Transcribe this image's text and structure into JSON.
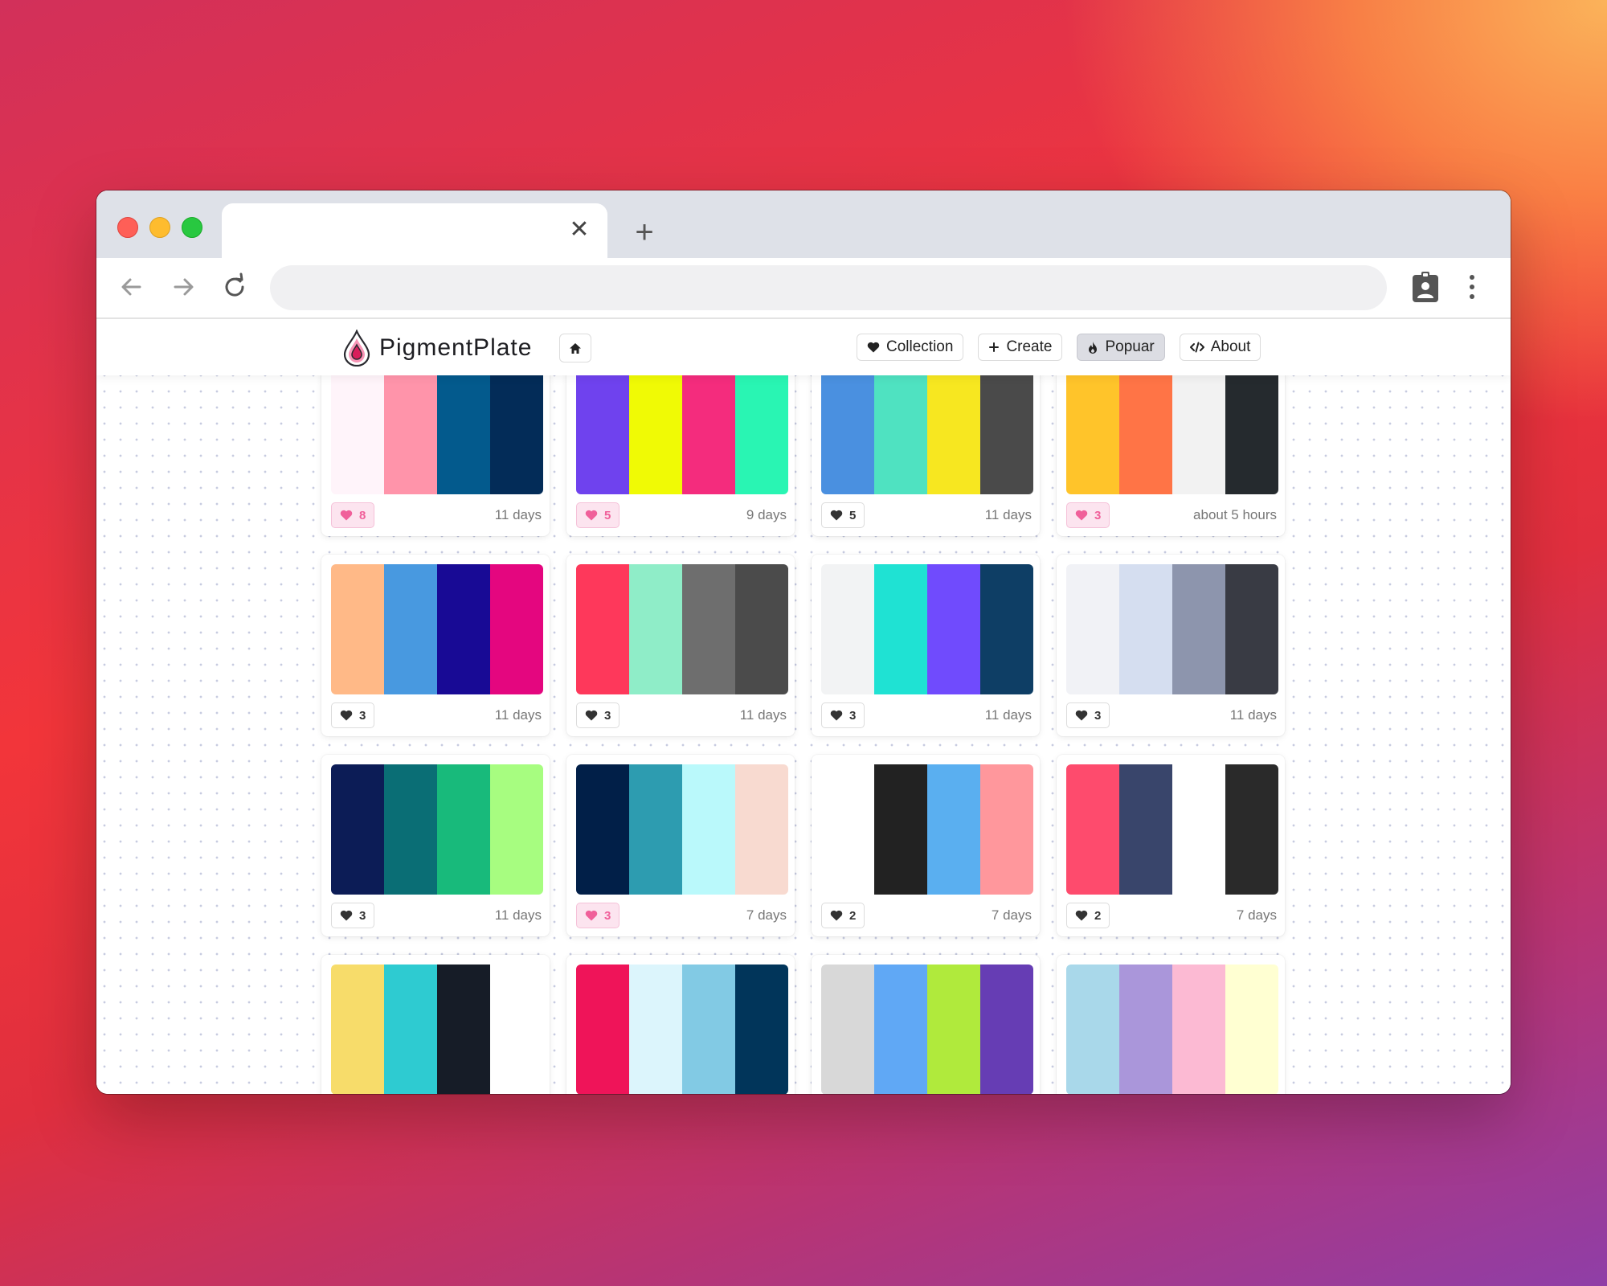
{
  "browser": {
    "tab_close_glyph": "✕",
    "new_tab_glyph": "+"
  },
  "site": {
    "brand": "PigmentPlate",
    "nav": [
      {
        "label": "Collection",
        "icon": "heart-icon"
      },
      {
        "label": "Create",
        "icon": "plus-icon"
      },
      {
        "label": "Popuar",
        "icon": "fire-icon",
        "active": true
      },
      {
        "label": "About",
        "icon": "code-icon"
      }
    ]
  },
  "palettes": [
    {
      "colors": [
        "#fff4fa",
        "#ff94aa",
        "#035a8d",
        "#032c58"
      ],
      "likes": "8",
      "liked": true,
      "age": "11 days"
    },
    {
      "colors": [
        "#6f42ee",
        "#f0fa05",
        "#f42c7d",
        "#29f5b3"
      ],
      "likes": "5",
      "liked": true,
      "age": "9 days"
    },
    {
      "colors": [
        "#4a90e0",
        "#4fe2c1",
        "#f7e720",
        "#4a4a4a"
      ],
      "likes": "5",
      "liked": false,
      "age": "11 days"
    },
    {
      "colors": [
        "#ffc42a",
        "#ff7446",
        "#f2f2f2",
        "#252a2e"
      ],
      "likes": "3",
      "liked": true,
      "age": "about 5 hours"
    },
    {
      "colors": [
        "#ffb987",
        "#4899e0",
        "#180a95",
        "#e4067f"
      ],
      "likes": "3",
      "liked": false,
      "age": "11 days"
    },
    {
      "colors": [
        "#fe385b",
        "#8fedc8",
        "#6e6e6e",
        "#4b4b4b"
      ],
      "likes": "3",
      "liked": false,
      "age": "11 days"
    },
    {
      "colors": [
        "#f2f3f4",
        "#1fe2d3",
        "#704bfd",
        "#0e3e65"
      ],
      "likes": "3",
      "liked": false,
      "age": "11 days"
    },
    {
      "colors": [
        "#f1f2f6",
        "#d5def0",
        "#8d95ad",
        "#393b44"
      ],
      "likes": "3",
      "liked": false,
      "age": "11 days"
    },
    {
      "colors": [
        "#0c1c56",
        "#0a6e75",
        "#18ba7b",
        "#a7fd80"
      ],
      "likes": "3",
      "liked": false,
      "age": "11 days"
    },
    {
      "colors": [
        "#011f48",
        "#2d9cb0",
        "#baf9fb",
        "#f8dad0"
      ],
      "likes": "3",
      "liked": true,
      "age": "7 days"
    },
    {
      "colors": [
        "#ffffff",
        "#222222",
        "#5aaff0",
        "#ff979c"
      ],
      "likes": "2",
      "liked": false,
      "age": "7 days"
    },
    {
      "colors": [
        "#fe4b6d",
        "#39456b",
        "#ffffff",
        "#2a2a2a"
      ],
      "likes": "2",
      "liked": false,
      "age": "7 days"
    },
    {
      "colors": [
        "#f7dc6a",
        "#2ecbd1",
        "#161c27",
        "#ffffff"
      ],
      "likes": "",
      "liked": false,
      "age": ""
    },
    {
      "colors": [
        "#ef1459",
        "#dcf5fc",
        "#82cae4",
        "#01355a"
      ],
      "likes": "",
      "liked": false,
      "age": ""
    },
    {
      "colors": [
        "#d8d8d8",
        "#60a8f5",
        "#b0ea3c",
        "#663db4"
      ],
      "likes": "",
      "liked": false,
      "age": ""
    },
    {
      "colors": [
        "#a9d8ea",
        "#aa96da",
        "#fcbad3",
        "#ffffd2"
      ],
      "likes": "",
      "liked": false,
      "age": ""
    }
  ]
}
